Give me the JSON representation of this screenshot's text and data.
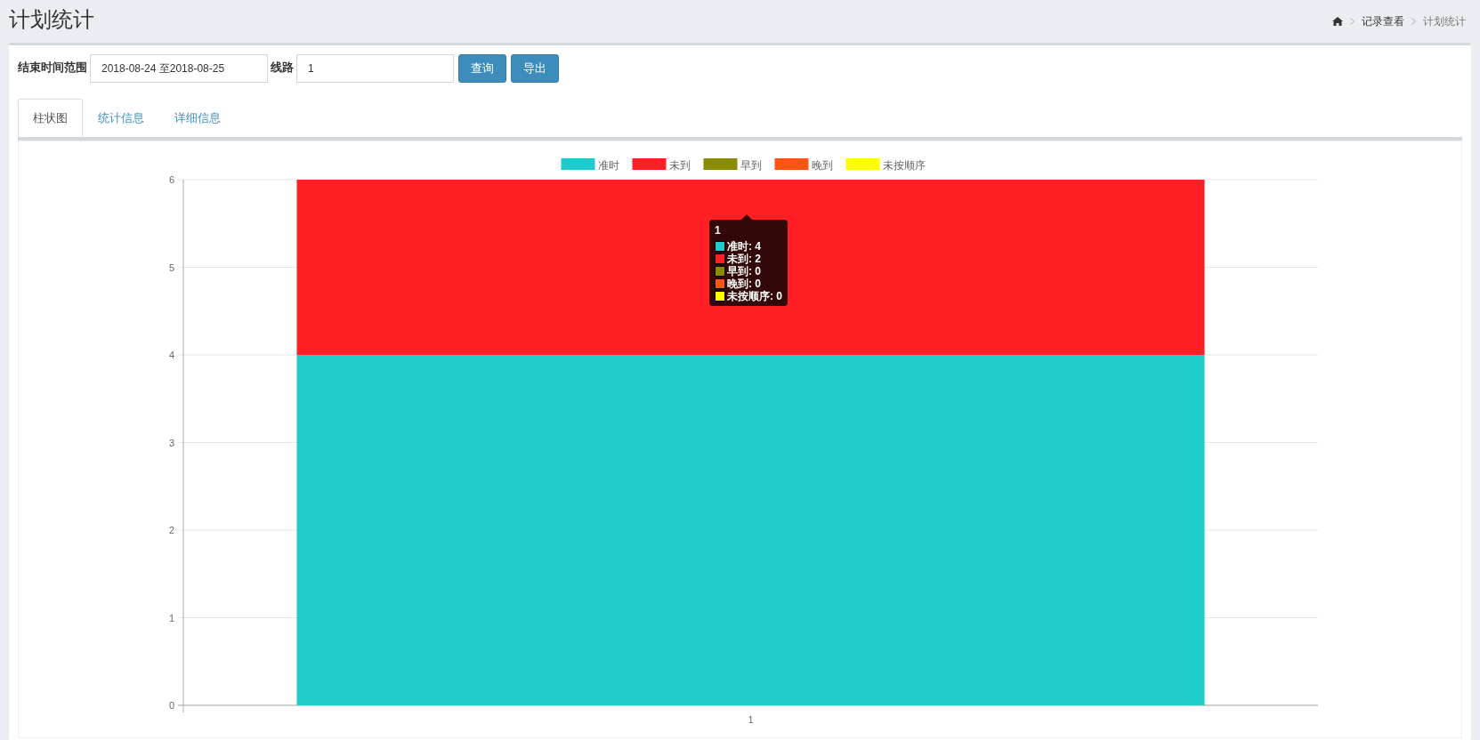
{
  "page_title": "计划统计",
  "breadcrumb": [
    "记录查看",
    "计划统计"
  ],
  "filters": {
    "date_label": "结束时间范围",
    "date_value": "2018-08-24 至2018-08-25",
    "route_label": "线路",
    "route_value": "1"
  },
  "buttons": [
    "查询",
    "导出"
  ],
  "tabs": [
    {
      "label": "柱状图",
      "selected": true
    },
    {
      "label": "统计信息",
      "selected": false
    },
    {
      "label": "详细信息",
      "selected": false
    }
  ],
  "chart": {
    "chart_data": {
      "type": "bar",
      "stacked": true,
      "grid": true,
      "legend": "top",
      "categories": [
        "1"
      ],
      "yticks": [
        0,
        1,
        2,
        3,
        4,
        5,
        6
      ],
      "ylim": [
        0,
        6
      ],
      "series": [
        {
          "name": "准时",
          "color": "#1fcccc",
          "values": [
            4
          ]
        },
        {
          "name": "未到",
          "color": "#ff1f24",
          "values": [
            2
          ]
        },
        {
          "name": "早到",
          "color": "#8b8b00",
          "values": [
            0
          ]
        },
        {
          "name": "晚到",
          "color": "#ff5510",
          "values": [
            0
          ]
        },
        {
          "name": "未按顺序",
          "color": "#ffff00",
          "values": [
            0
          ]
        }
      ]
    },
    "tooltip": {
      "title": "1",
      "items": [
        "准时: 4",
        "未到: 2",
        "早到: 0",
        "晚到: 0",
        "未按顺序: 0"
      ]
    }
  }
}
